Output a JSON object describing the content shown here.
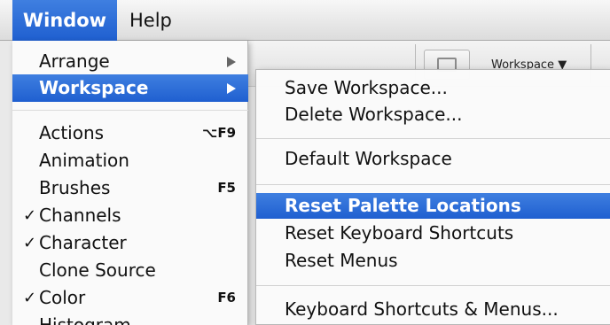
{
  "menubar": {
    "window": "Window",
    "help": "Help"
  },
  "toolbar": {
    "workspace_label": "Workspace ▼"
  },
  "window_menu": {
    "items": [
      {
        "label": "Arrange",
        "check": "",
        "shortcut": "",
        "has_submenu": true
      },
      {
        "label": "Workspace",
        "check": "",
        "shortcut": "",
        "has_submenu": true
      },
      {
        "label": "Actions",
        "check": "",
        "shortcut": "⌥F9"
      },
      {
        "label": "Animation",
        "check": "",
        "shortcut": ""
      },
      {
        "label": "Brushes",
        "check": "",
        "shortcut": "F5"
      },
      {
        "label": "Channels",
        "check": "✓",
        "shortcut": ""
      },
      {
        "label": "Character",
        "check": "✓",
        "shortcut": ""
      },
      {
        "label": "Clone Source",
        "check": "",
        "shortcut": ""
      },
      {
        "label": "Color",
        "check": "✓",
        "shortcut": "F6"
      },
      {
        "label": "Histogram",
        "check": "",
        "shortcut": ""
      }
    ]
  },
  "workspace_submenu": {
    "items": [
      {
        "label": "Save Workspace..."
      },
      {
        "label": "Delete Workspace..."
      },
      {
        "label": "Default Workspace"
      },
      {
        "label": "Reset Palette Locations"
      },
      {
        "label": "Reset Keyboard Shortcuts"
      },
      {
        "label": "Reset Menus"
      },
      {
        "label": "Keyboard Shortcuts & Menus..."
      }
    ]
  },
  "colors": {
    "highlight": "#2f6fd8",
    "menu_bg": "#fafafa"
  }
}
